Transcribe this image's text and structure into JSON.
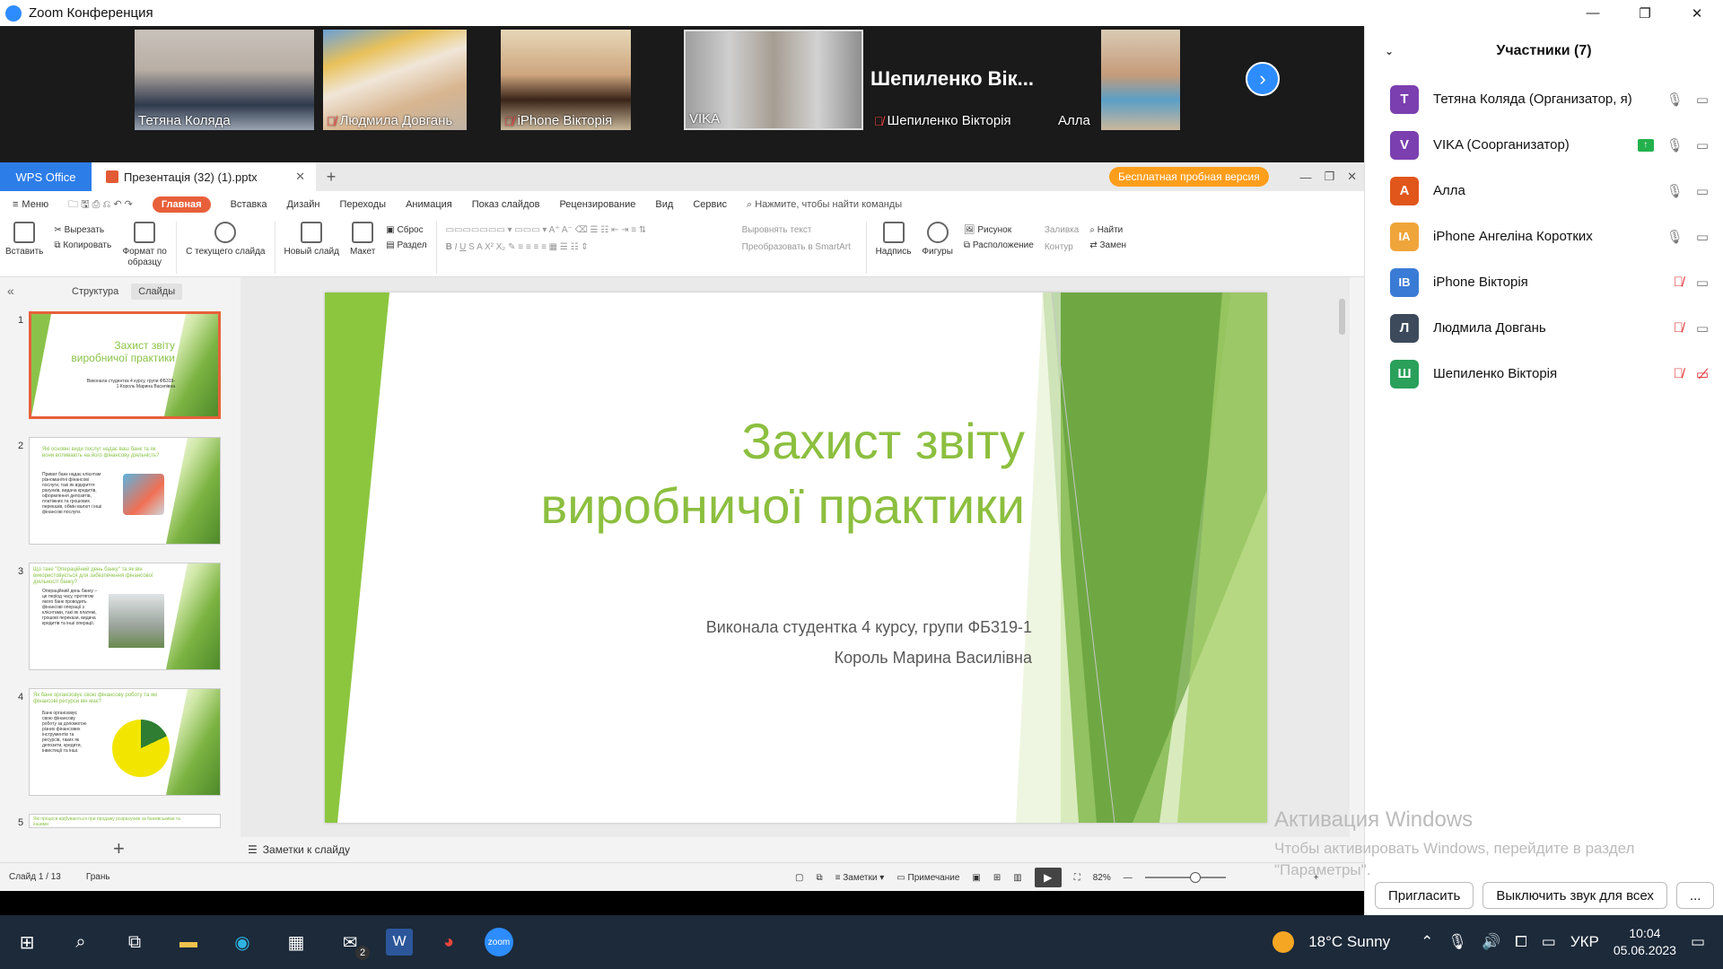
{
  "zoom": {
    "title": "Zoom Конференция",
    "video_tiles": [
      {
        "name": "Тетяна Коляда",
        "muted": false
      },
      {
        "name": "Людмила Довгань",
        "muted": true
      },
      {
        "name": "iPhone Вікторія",
        "muted": true
      },
      {
        "name": "VIKA",
        "muted": false
      },
      {
        "name": "Шепиленко Вікторія",
        "muted": true
      },
      {
        "name": "Алла",
        "muted": false
      }
    ],
    "big_name": "Шепиленко Вік...",
    "participants_title": "Участники (7)",
    "participants": [
      {
        "initials": "Т",
        "name": "Тетяна Коляда (Организатор, я)",
        "color": "#7b3fb0",
        "mic": "on"
      },
      {
        "initials": "V",
        "name": "VIKA (Соорганизатор)",
        "color": "#7b3fb0",
        "mic": "on",
        "sharing": true
      },
      {
        "initials": "А",
        "name": "Алла",
        "color": "#e0561b",
        "mic": "on"
      },
      {
        "initials": "IA",
        "name": "iPhone Ангеліна Коротких",
        "color": "#f0a53a",
        "mic": "on"
      },
      {
        "initials": "IB",
        "name": "iPhone Вікторія",
        "color": "#3a7bd5",
        "mic": "off"
      },
      {
        "initials": "Л",
        "name": "Людмила Довгань",
        "color": "#3d4a5c",
        "mic": "off"
      },
      {
        "initials": "Ш",
        "name": "Шепиленко Вікторія",
        "color": "#2aa05a",
        "mic": "off",
        "video_off": true
      }
    ],
    "invite_btn": "Пригласить",
    "mute_all_btn": "Выключить звук для всех",
    "more_btn": "...",
    "activation_title": "Активация Windows",
    "activation_text": "Чтобы активировать Windows, перейдите в раздел \"Параметры\"."
  },
  "wps": {
    "brand": "WPS Office",
    "doc_tab": "Презентація (32) (1).pptx",
    "trial": "Бесплатная пробная версия",
    "menu": [
      "Меню",
      "Главная",
      "Вставка",
      "Дизайн",
      "Переходы",
      "Анимация",
      "Показ слайдов",
      "Рецензирование",
      "Вид",
      "Сервис"
    ],
    "search_hint": "Нажмите, чтобы найти команды",
    "ribbon": {
      "paste": "Вставить",
      "cut": "Вырезать",
      "copy": "Копировать",
      "format": "Формат по образцу",
      "from_current": "С текущего слайда",
      "new_slide": "Новый слайд",
      "layout": "Макет",
      "reset": "Сброс",
      "section": "Раздел",
      "align_text": "Выровнять текст",
      "to_smartart": "Преобразовать в SmartArt",
      "textbox": "Надпись",
      "shapes": "Фигуры",
      "picture": "Рисунок",
      "arrange": "Расположение",
      "fill": "Заливка",
      "outline": "Контур",
      "find": "Найти",
      "replace": "Замен"
    },
    "pane_tabs": [
      "Структура",
      "Слайды"
    ],
    "thumbs": [
      {
        "num": "1",
        "title": "Захист звіту виробничої практики",
        "sub": "Виконала студентка 4 курсу, групи ФБ319-1 Король Марина Василівна"
      },
      {
        "num": "2",
        "title": "Які основні види послуг надає ваш банк та як вони впливають на його фінансову діяльність?",
        "sub": "Приват банк надає клієнтам різноманітні фінансові послуги, такі як відкриття рахунків, видача кредитів, оформлення депозитів, платіжних та грошових переказів, обмін валют і інші фінансові послуги."
      },
      {
        "num": "3",
        "title": "Що таке \"Операційний день банку\" та як він використовується для забезпечення фінансової діяльності банку?",
        "sub": "Операційний день банку – це період часу, протягом якого банк проводить фінансові операції з клієнтами, такі як платежі, грошові перекази, видача кредитів та інші операції."
      },
      {
        "num": "4",
        "title": "Як банк організовує свою фінансову роботу та які фінансові ресурси він має?",
        "sub": "Банк організовує свою фінансову роботу за допомогою різних фінансових інструментів та ресурсів, таких як депозити, кредити, інвестиції та інші."
      },
      {
        "num": "5",
        "title": "Які процеси відбуваються при продажу розрахунків за банківськими та іншими",
        "sub": ""
      }
    ],
    "slide": {
      "title_line1": "Захист звіту",
      "title_line2": "виробничої практики",
      "sub_line1": "Виконала студентка 4 курсу, групи ФБ319-1",
      "sub_line2": "Король Марина Василівна"
    },
    "notes_label": "Заметки к слайду",
    "status": {
      "slide_of": "Слайд 1 / 13",
      "theme": "Грань",
      "notes": "Заметки",
      "comment": "Примечание",
      "zoom": "82%"
    }
  },
  "taskbar": {
    "weather": "18°C Sunny",
    "lang": "УКР",
    "time": "10:04",
    "date": "05.06.2023",
    "mail_badge": "2"
  }
}
